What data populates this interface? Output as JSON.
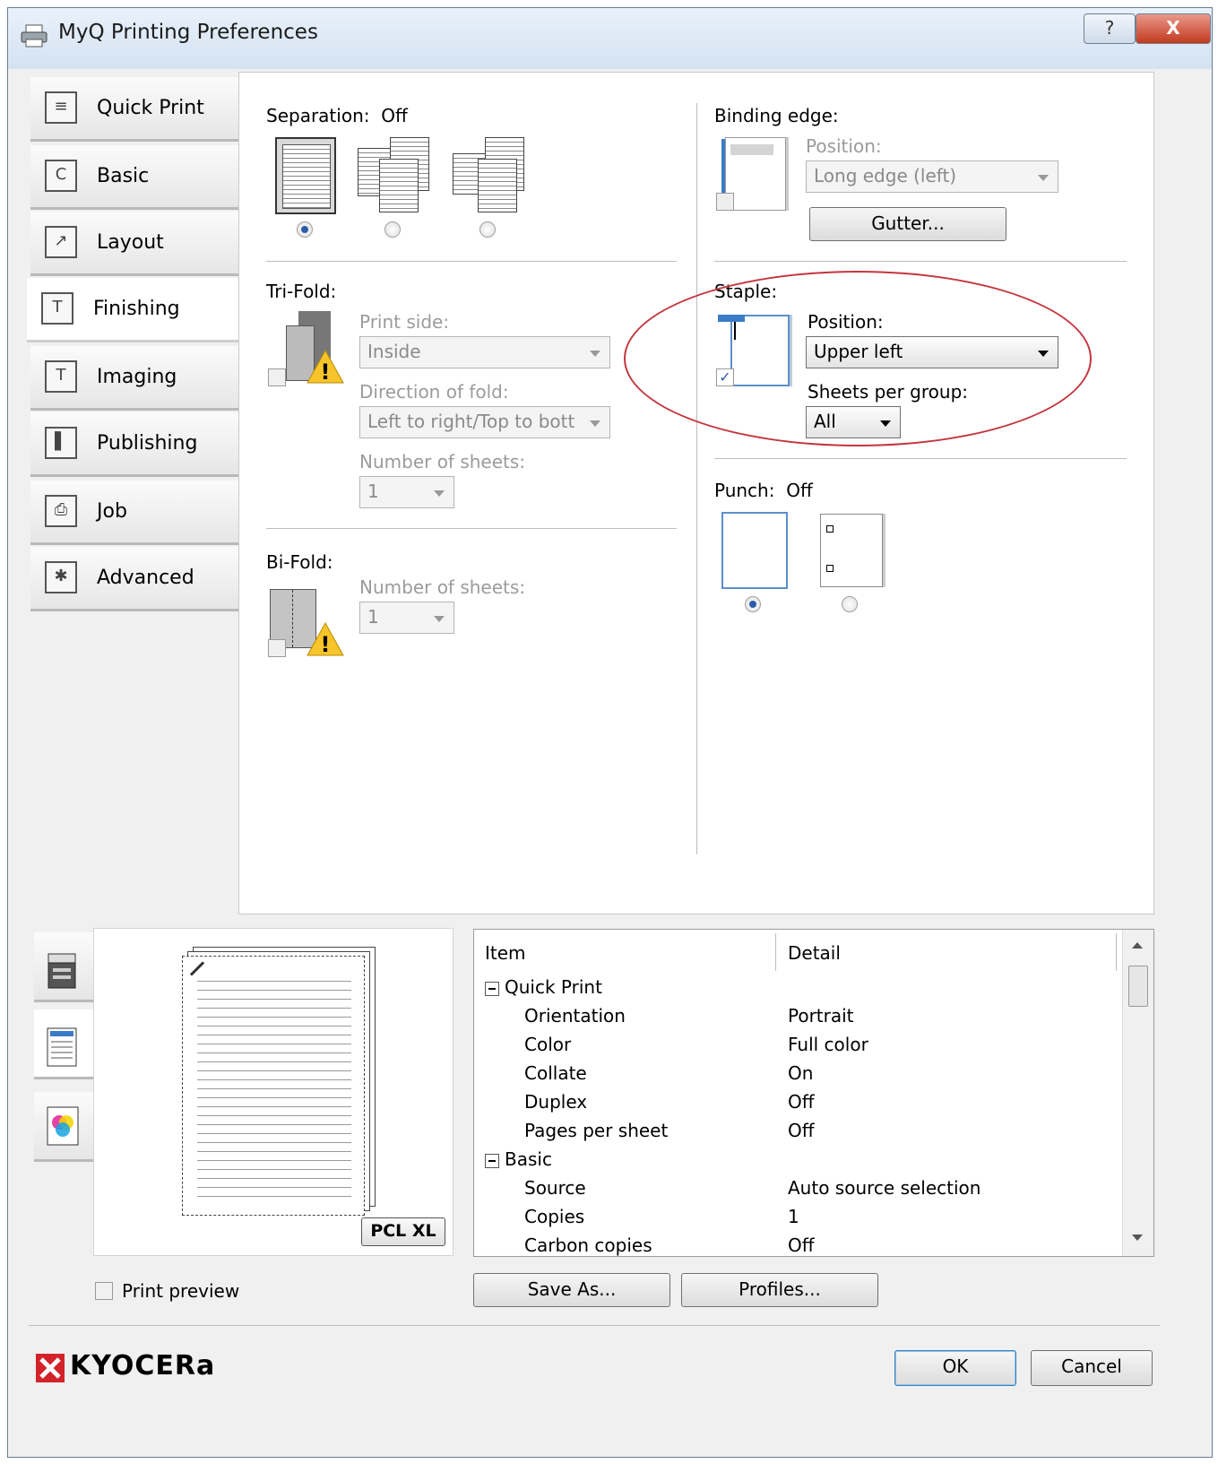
{
  "window": {
    "title": "MyQ Printing Preferences",
    "help": "?",
    "close": "X"
  },
  "nav": [
    {
      "label": "Quick Print",
      "glyph": "≡"
    },
    {
      "label": "Basic",
      "glyph": "C"
    },
    {
      "label": "Layout",
      "glyph": "↗"
    },
    {
      "label": "Finishing",
      "glyph": "T"
    },
    {
      "label": "Imaging",
      "glyph": "T"
    },
    {
      "label": "Publishing",
      "glyph": "▌"
    },
    {
      "label": "Job",
      "glyph": "⎙"
    },
    {
      "label": "Advanced",
      "glyph": "✱"
    }
  ],
  "separation": {
    "label": "Separation:",
    "value": "Off",
    "selected": 0
  },
  "trifold": {
    "label": "Tri-Fold:",
    "print_side_label": "Print side:",
    "print_side_value": "Inside",
    "direction_label": "Direction of fold:",
    "direction_value": "Left to right/Top to bott",
    "sheets_label": "Number of sheets:",
    "sheets_value": "1"
  },
  "bifold": {
    "label": "Bi-Fold:",
    "sheets_label": "Number of sheets:",
    "sheets_value": "1"
  },
  "binding": {
    "label": "Binding edge:",
    "position_label": "Position:",
    "position_value": "Long edge (left)",
    "gutter_button": "Gutter..."
  },
  "staple": {
    "label": "Staple:",
    "checked": true,
    "check_glyph": "✓",
    "position_label": "Position:",
    "position_value": "Upper left",
    "sheets_label": "Sheets per group:",
    "sheets_value": "All",
    "highlight_color": "#c3363f"
  },
  "punch": {
    "label": "Punch:",
    "value": "Off",
    "selected": 0
  },
  "preview": {
    "format_badge": "PCL XL",
    "print_preview_label": "Print preview",
    "print_preview_checked": false
  },
  "summary": {
    "col_item": "Item",
    "col_detail": "Detail",
    "rows": [
      {
        "group": true,
        "item": "Quick Print",
        "detail": ""
      },
      {
        "group": false,
        "item": "Orientation",
        "detail": "Portrait"
      },
      {
        "group": false,
        "item": "Color",
        "detail": "Full color"
      },
      {
        "group": false,
        "item": "Collate",
        "detail": "On"
      },
      {
        "group": false,
        "item": "Duplex",
        "detail": "Off"
      },
      {
        "group": false,
        "item": "Pages per sheet",
        "detail": "Off"
      },
      {
        "group": true,
        "item": "Basic",
        "detail": ""
      },
      {
        "group": false,
        "item": "Source",
        "detail": "Auto source selection"
      },
      {
        "group": false,
        "item": "Copies",
        "detail": "1"
      },
      {
        "group": false,
        "item": "Carbon copies",
        "detail": "Off"
      }
    ]
  },
  "buttons": {
    "save_as": "Save As...",
    "profiles": "Profiles...",
    "ok": "OK",
    "cancel": "Cancel"
  },
  "brand": {
    "name": "KYOCERa",
    "color": "#d2232a"
  }
}
